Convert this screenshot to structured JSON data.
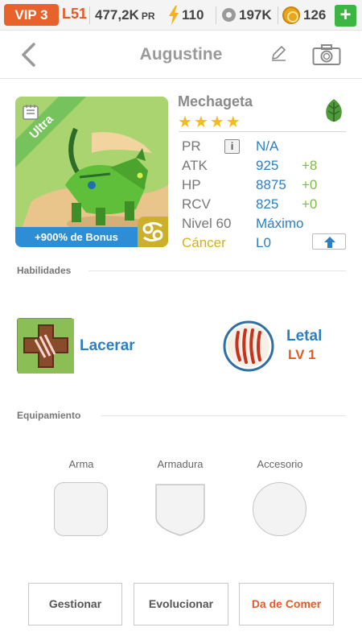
{
  "topbar": {
    "vip": "VIP 3",
    "level": "L51",
    "power": "477,2K",
    "power_unit": "PR",
    "energy": "110",
    "food": "197K",
    "gold": "126",
    "add_label": "+"
  },
  "header": {
    "title": "Augustine"
  },
  "monster": {
    "rarity": "Ultra",
    "bonus": "+900% de Bonus",
    "name": "Mechageta",
    "stars": "★★★★",
    "element_icon": "leaf-icon",
    "stats": {
      "pr_label": "PR",
      "pr_value": "N/A",
      "atk_label": "ATK",
      "atk_value": "925",
      "atk_inc": "+8",
      "hp_label": "HP",
      "hp_value": "8875",
      "hp_inc": "+0",
      "rcv_label": "RCV",
      "rcv_value": "825",
      "rcv_inc": "+0",
      "level_label": "Nivel 60",
      "level_value": "Máximo",
      "sign_label": "Cáncer",
      "sign_value": "L0"
    }
  },
  "skills": {
    "title": "Habilidades",
    "active_name": "Lacerar",
    "passive_name": "Letal",
    "passive_level": "LV 1"
  },
  "equipment": {
    "title": "Equipamiento",
    "weapon": "Arma",
    "armor": "Armadura",
    "accessory": "Accesorio"
  },
  "buttons": {
    "manage": "Gestionar",
    "evolve": "Evolucionar",
    "feed": "Da de Comer"
  },
  "colors": {
    "accent_orange": "#e8632c",
    "stat_blue": "#2c7fc4",
    "increment_green": "#7cbc42",
    "sign_gold": "#d5b118"
  }
}
